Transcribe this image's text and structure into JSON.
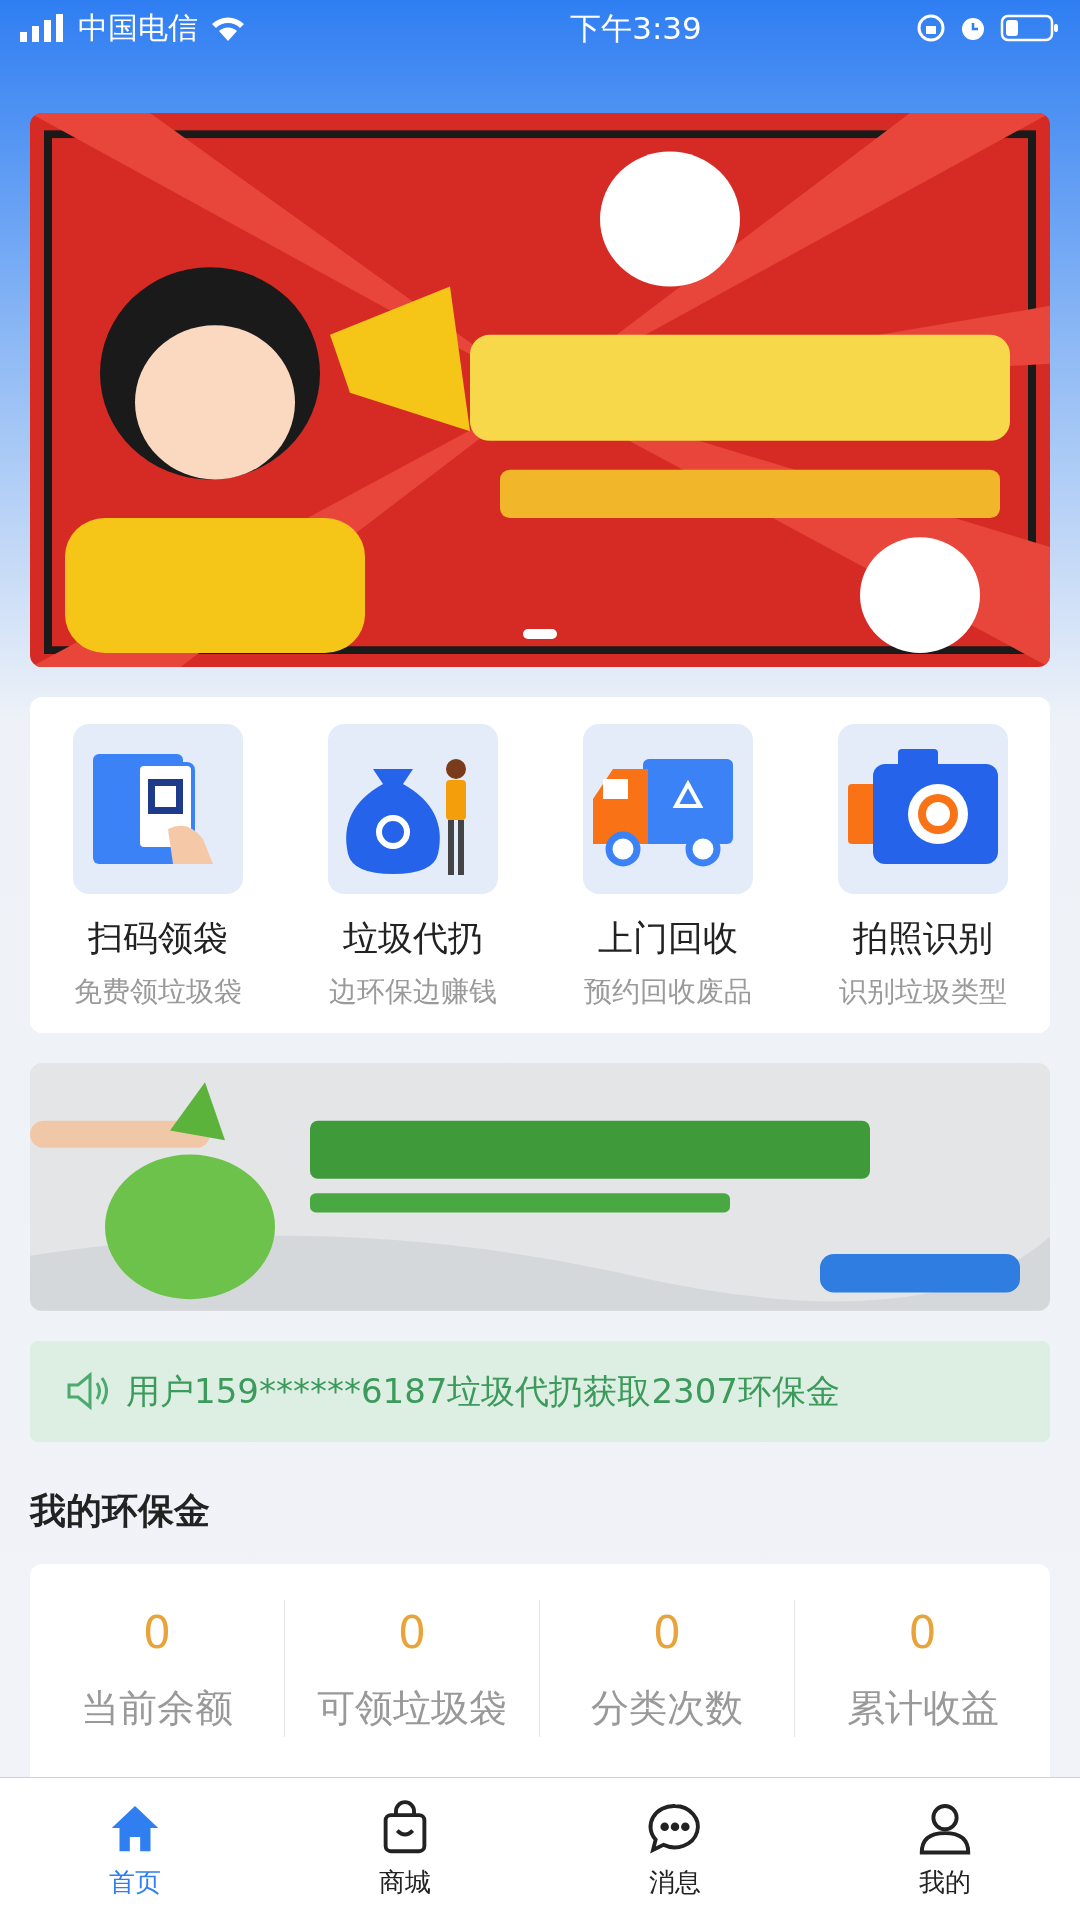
{
  "status_bar": {
    "carrier": "中国电信",
    "time": "下午3:39"
  },
  "services": [
    {
      "kind": "qr",
      "title": "扫码领袋",
      "subtitle": "免费领垃圾袋"
    },
    {
      "kind": "bag",
      "title": "垃圾代扔",
      "subtitle": "边环保边赚钱"
    },
    {
      "kind": "truck",
      "title": "上门回收",
      "subtitle": "预约回收废品"
    },
    {
      "kind": "camera",
      "title": "拍照识别",
      "subtitle": "识别垃圾类型"
    }
  ],
  "notice": {
    "text": "用户159******6187垃圾代扔获取2307环保金"
  },
  "wallet": {
    "title": "我的环保金",
    "stats": [
      {
        "value": "0",
        "label": "当前余额"
      },
      {
        "value": "0",
        "label": "可领垃圾袋"
      },
      {
        "value": "0",
        "label": "分类次数"
      },
      {
        "value": "0",
        "label": "累计收益"
      }
    ]
  },
  "tab_bar": [
    {
      "kind": "home",
      "label": "首页",
      "selected": true
    },
    {
      "kind": "shop",
      "label": "商城",
      "selected": false
    },
    {
      "kind": "message",
      "label": "消息",
      "selected": false
    },
    {
      "kind": "profile",
      "label": "我的",
      "selected": false
    }
  ]
}
